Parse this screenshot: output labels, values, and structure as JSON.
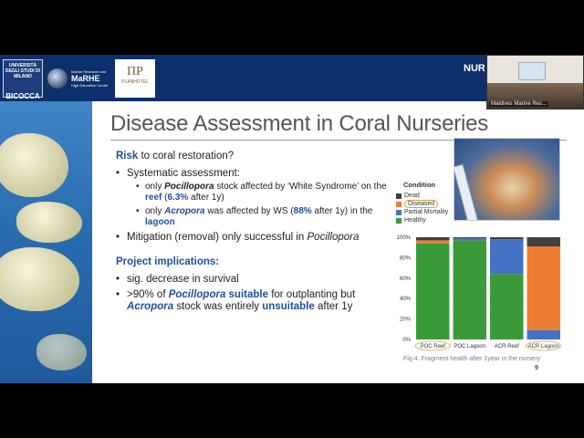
{
  "header": {
    "logo_uni_small": "UNIVERSITÀ DEGLI STUDI DI MILANO",
    "logo_uni_big": "BICOCCA",
    "logo_marhe_small": "Marine Research and",
    "logo_marhe_big": "MaRHE",
    "logo_marhe_sub": "High Education Center",
    "logo_plan_mark": "ΠP",
    "logo_plan_name": "PLANHOTEL",
    "partial_text": "NUR"
  },
  "webcam": {
    "label": "Maldives Marine Res..."
  },
  "slide": {
    "title": "Disease Assessment in Coral Nurseries",
    "risk_label": "Risk",
    "risk_text": " to coral restoration?",
    "bullet_systematic": "Systematic assessment:",
    "sub1_a": "only ",
    "sub1_b": "Pocillopora",
    "sub1_c": " stock affected by ‘White Syndrome’ on the ",
    "sub1_d": "reef",
    "sub1_e": " (",
    "sub1_f": "6.3%",
    "sub1_g": " after 1y)",
    "sub2_a": "only ",
    "sub2_b": "Acropora",
    "sub2_c": " was affected by WS (",
    "sub2_d": "88%",
    "sub2_e": " after 1y) in the ",
    "sub2_f": "lagoon",
    "bullet_mitigation_a": "Mitigation (removal) only successful in ",
    "bullet_mitigation_b": "Pocillopora",
    "project_label": "Project implications:",
    "impl1": "sig. decrease in survival",
    "impl2_a": ">90% of ",
    "impl2_b": "Pocillopora",
    "impl2_c": " suitable",
    "impl2_d": " for outplanting but ",
    "impl2_e": "Acropora",
    "impl2_f": " stock was entirely ",
    "impl2_g": "unsuitable",
    "impl2_h": " after 1y",
    "figure_caption": "Fig.4. Fragment health after 1year in the nursery",
    "page_number": "9"
  },
  "legend": {
    "title": "Condition",
    "items": [
      {
        "label": "Dead",
        "color": "#404040"
      },
      {
        "label": "Diseased",
        "color": "#ed7d31"
      },
      {
        "label": "Partial Mortality",
        "color": "#4472c4"
      },
      {
        "label": "Healthy",
        "color": "#3a9a3a"
      }
    ]
  },
  "chart_data": {
    "type": "bar",
    "stacked": true,
    "categories": [
      "POC Reef",
      "POC Lagoon",
      "ACR Reef",
      "ACR Lagoon"
    ],
    "yticks": [
      "0%",
      "20%",
      "40%",
      "60%",
      "80%",
      "100%"
    ],
    "ylim": [
      0,
      100
    ],
    "series": [
      {
        "name": "Healthy",
        "color": "#3a9a3a",
        "values": [
          94,
          97,
          64,
          0
        ]
      },
      {
        "name": "Partial Mortality",
        "color": "#4472c4",
        "values": [
          0,
          2,
          34,
          9
        ]
      },
      {
        "name": "Diseased",
        "color": "#ed7d31",
        "values": [
          3,
          0,
          0,
          82
        ]
      },
      {
        "name": "Dead",
        "color": "#404040",
        "values": [
          3,
          1,
          2,
          9
        ]
      }
    ]
  }
}
